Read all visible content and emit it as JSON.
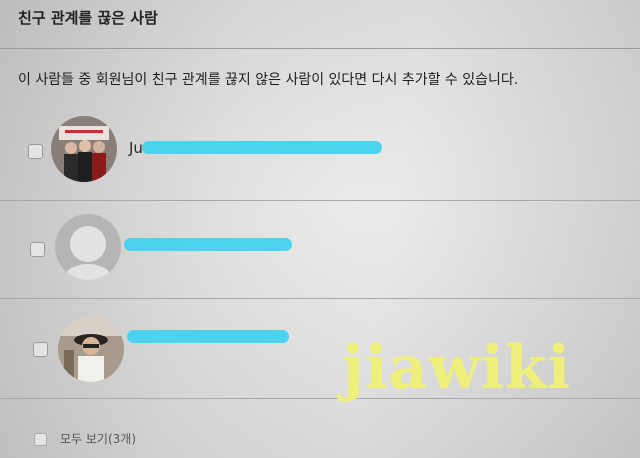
{
  "header": {
    "title": "친구 관계를 끊은 사람"
  },
  "description": "이 사람들 중 회원님이 친구 관계를 끊지 않은 사람이 있다면 다시 추가할 수 있습니다.",
  "people": [
    {
      "name": "Ju",
      "avatar_icon": "photo-avatar-icon"
    },
    {
      "name": "",
      "avatar_icon": "default-person-silhouette-icon"
    },
    {
      "name": "",
      "avatar_icon": "photo-avatar-icon"
    }
  ],
  "footer": {
    "show_all_label": "모두 보기(3개)"
  },
  "watermark": "jiawiki",
  "colors": {
    "redaction": "#40d0f0",
    "watermark": "#eef07a"
  }
}
